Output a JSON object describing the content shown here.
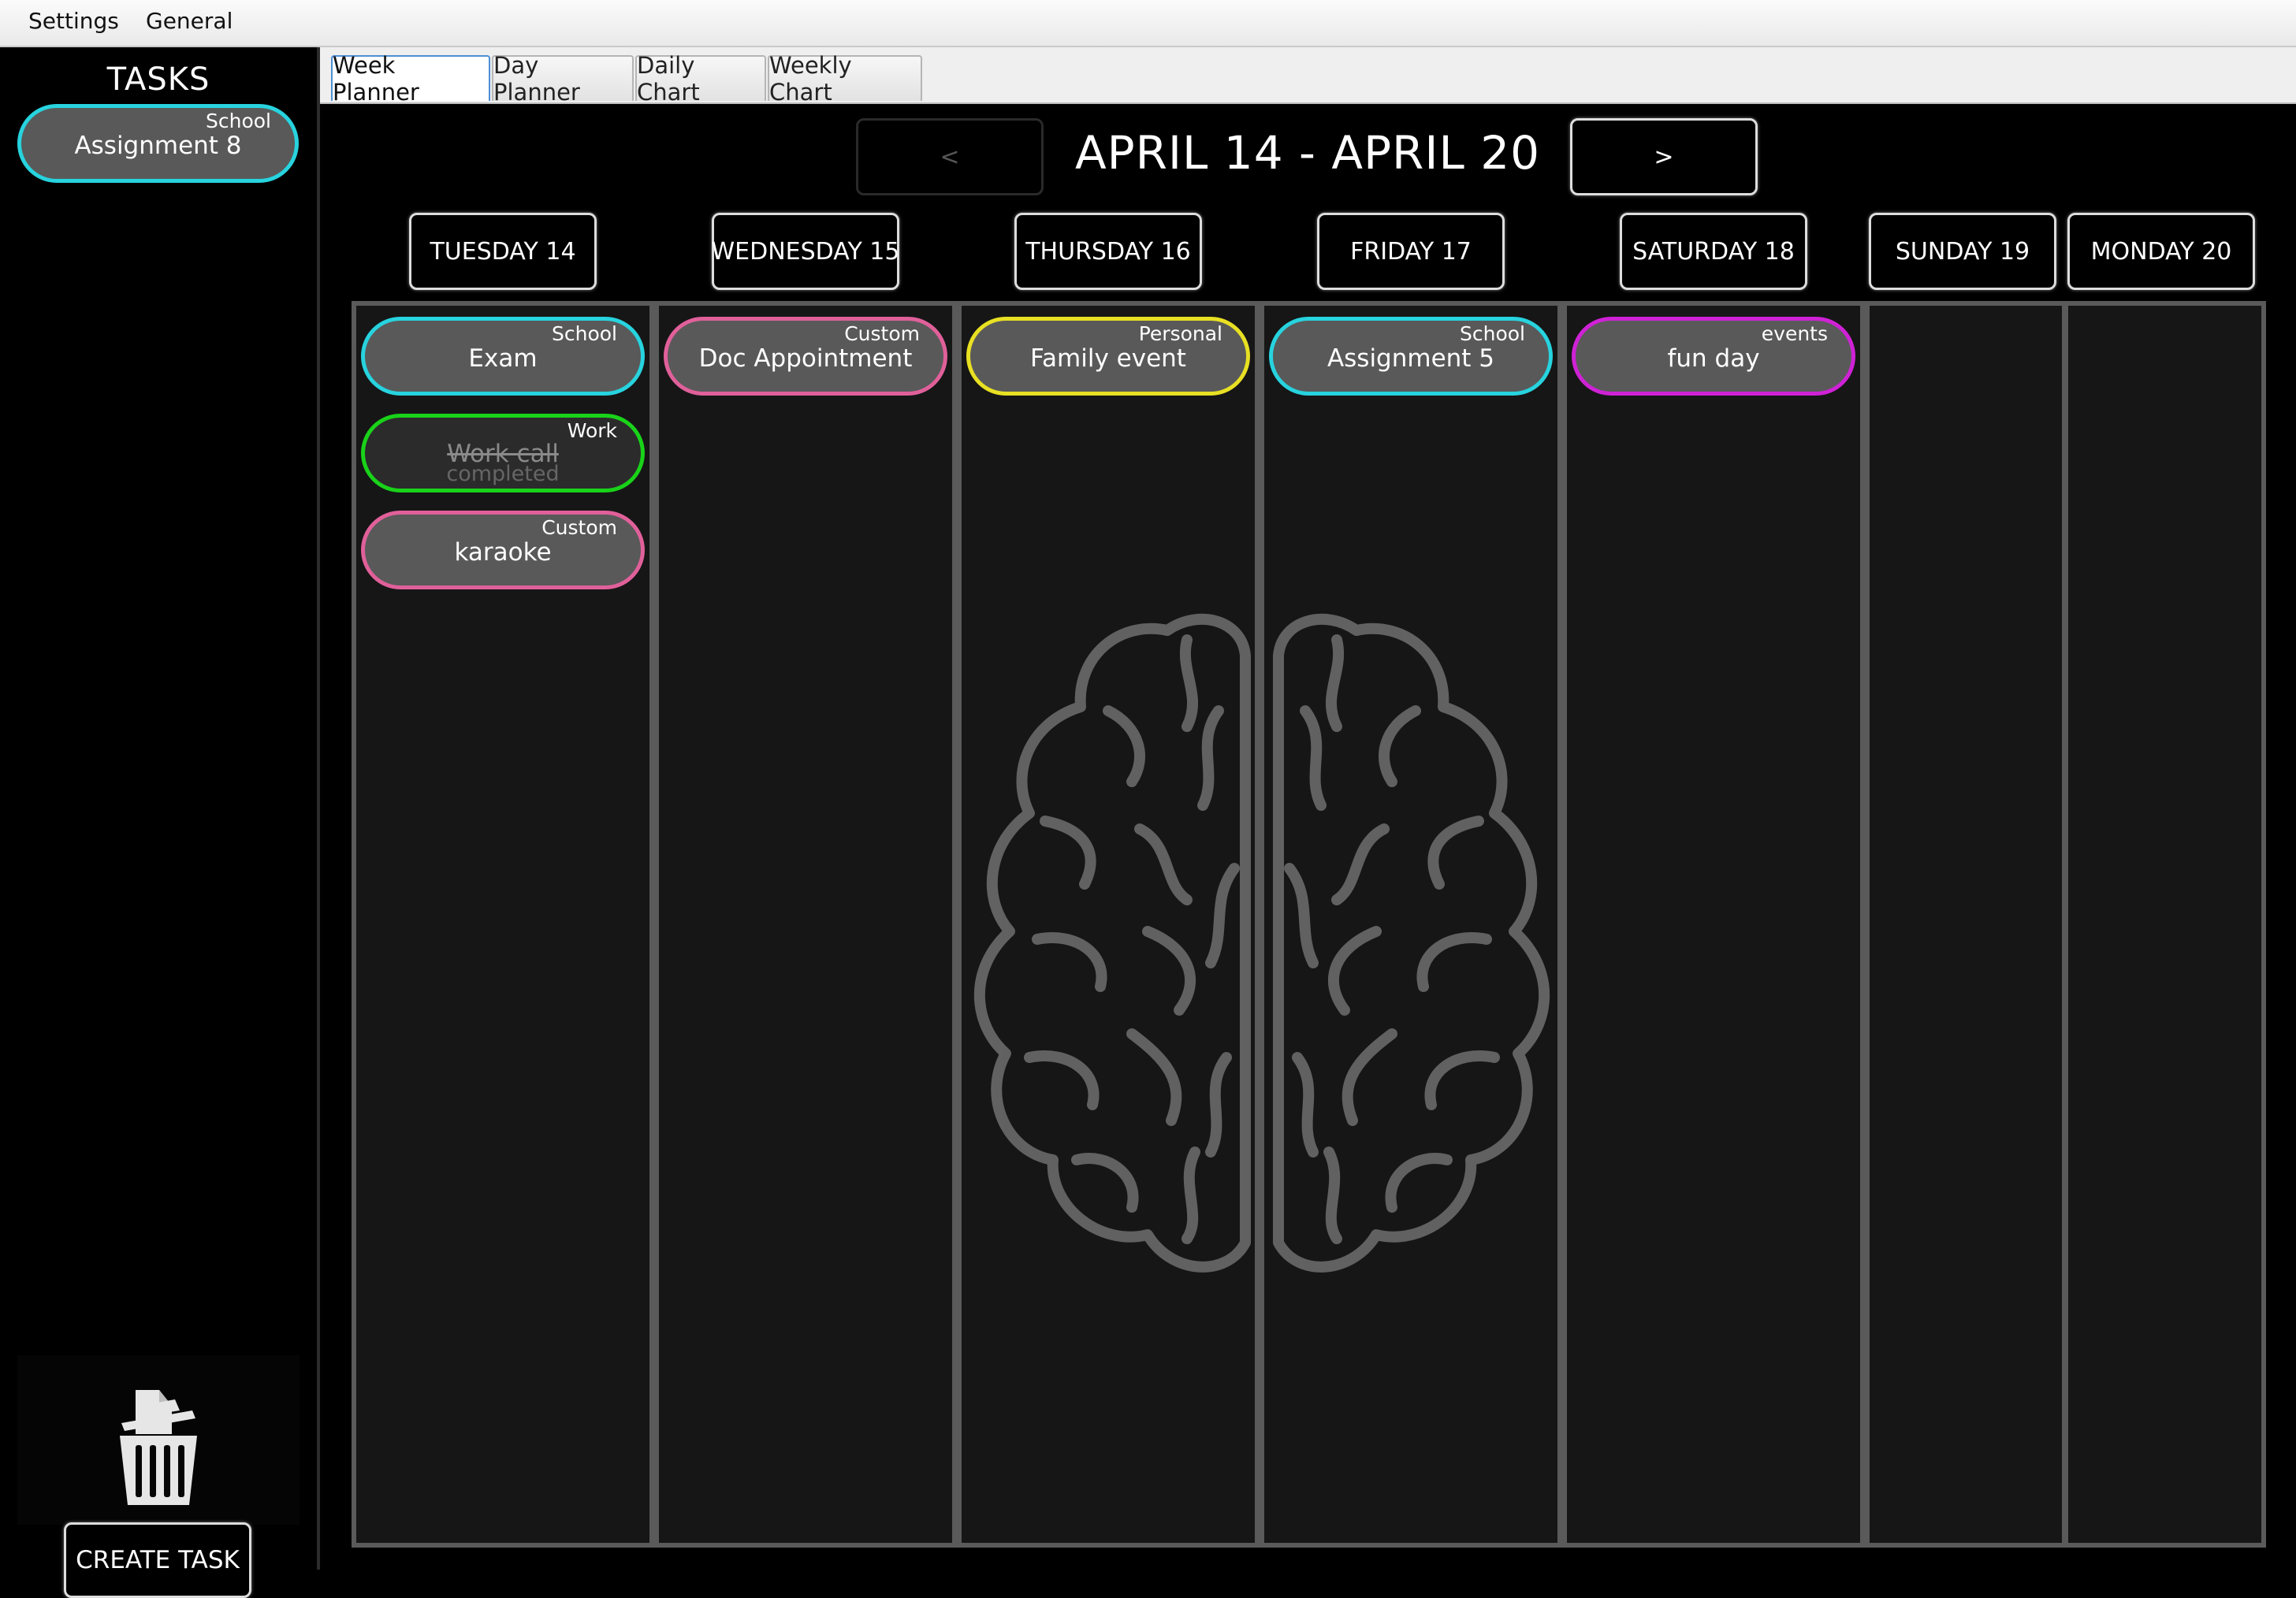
{
  "menu": {
    "settings": "Settings",
    "general": "General"
  },
  "sidebar": {
    "title": "TASKS",
    "tasks": [
      {
        "category": "School",
        "name": "Assignment 8",
        "color": "#27d3de"
      }
    ],
    "trash_icon": "trash-icon",
    "create_task_label": "CREATE TASK"
  },
  "tabs": [
    "Week Planner",
    "Day Planner",
    "Daily Chart",
    "Weekly Chart"
  ],
  "active_tab": "Week Planner",
  "week": {
    "prev_label": "<",
    "title": "APRIL 14 - APRIL 20",
    "next_label": ">"
  },
  "days": [
    {
      "label": "TUESDAY 14",
      "tasks": [
        {
          "category": "School",
          "name": "Exam",
          "color": "#27d3de"
        },
        {
          "category": "Work",
          "name": "Work call",
          "status": "completed",
          "color": "#19d219"
        },
        {
          "category": "Custom",
          "name": "karaoke",
          "color": "#e0609a"
        }
      ]
    },
    {
      "label": "WEDNESDAY 15",
      "tasks": [
        {
          "category": "Custom",
          "name": "Doc Appointment",
          "color": "#e0609a"
        }
      ]
    },
    {
      "label": "THURSDAY 16",
      "tasks": [
        {
          "category": "Personal",
          "name": "Family event",
          "color": "#e8e023"
        }
      ]
    },
    {
      "label": "FRIDAY 17",
      "tasks": [
        {
          "category": "School",
          "name": "Assignment 5",
          "color": "#27d3de"
        }
      ]
    },
    {
      "label": "SATURDAY 18",
      "tasks": [
        {
          "category": "events",
          "name": "fun day",
          "color": "#cf22d6"
        }
      ]
    },
    {
      "label": "SUNDAY 19",
      "tasks": []
    },
    {
      "label": "MONDAY 20",
      "tasks": []
    }
  ],
  "background_icon": "brain-icon"
}
